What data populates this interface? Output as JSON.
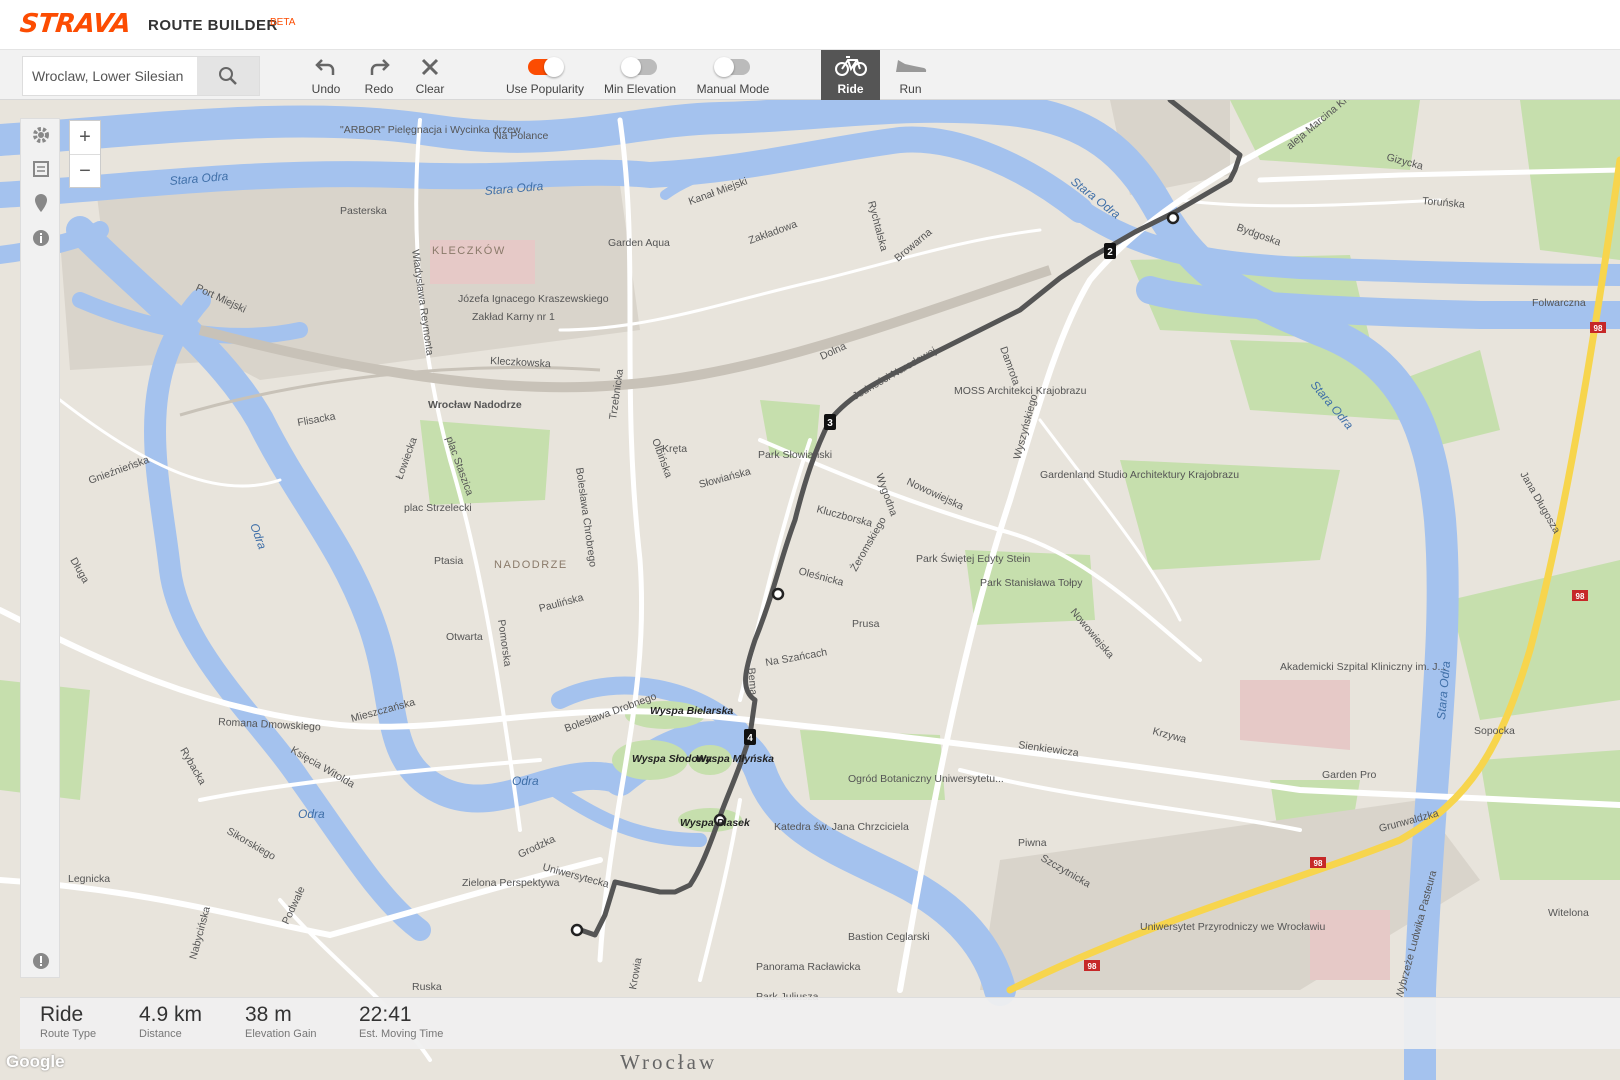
{
  "header": {
    "logo": "STRAVA",
    "title": "ROUTE BUILDER",
    "beta": "BETA"
  },
  "search": {
    "value": "Wroclaw, Lower Silesian",
    "placeholder": "Search"
  },
  "toolbar": {
    "undo": "Undo",
    "redo": "Redo",
    "clear": "Clear",
    "use_popularity": {
      "label": "Use Popularity",
      "on": true
    },
    "min_elevation": {
      "label": "Min Elevation",
      "on": false
    },
    "manual_mode": {
      "label": "Manual Mode",
      "on": false
    },
    "ride": "Ride",
    "run": "Run",
    "active_tab": "Ride"
  },
  "colors": {
    "brand": "#fc4c02",
    "route": "#555555",
    "water": "#a4c2ee",
    "park": "#c6dfad",
    "land": "#e8e4dc"
  },
  "map": {
    "waypoints": [
      "2",
      "3",
      "4"
    ],
    "labels": {
      "water": [
        "Stara Odra",
        "Stara Odra",
        "Odra",
        "Odra",
        "Odra",
        "Stara Odra",
        "Stara Odra",
        "Stara Odra",
        "Kanał Miejski",
        "Port Miejski"
      ],
      "districts": [
        "KLECZKÓW",
        "NADODRZE"
      ],
      "islands": [
        "Wyspa Bielarska",
        "Wyspa Słodowa",
        "Wyspa Młyńska",
        "Wyspa Piasek"
      ],
      "places": [
        "Wrocław Nadodrze",
        "Park Słowiański",
        "Park Stanisława Tołpy",
        "Ogród Botaniczny Uniwersytetu...",
        "Katedra św. Jana Chrzciciela",
        "Bastion Ceglarski",
        "Panorama Racławicka",
        "Zakład Karny nr 1",
        "Józefa Ignacego Kraszewskiego",
        "Garden Aqua",
        "\"ARBOR\" Pielęgnacja i Wycinka drzew",
        "MOSS Architekci Krajobrazu",
        "Gardenland Studio Architektury Krajobrazu",
        "Park Świętej Edyty Stein",
        "Akademicki Szpital Kliniczny im. J...",
        "Uniwersytet Przyrodniczy we Wrocławiu",
        "Garden Pro",
        "Zielona Perspektywa",
        "Park Juliusza"
      ],
      "streets": [
        "Na Polance",
        "Pasterska",
        "Zakładowa",
        "Rychtalska",
        "Browarna",
        "Toruńska",
        "Bydgoska",
        "Gizycka",
        "Folwarczna",
        "aleja Marcina Kromera",
        "Dolna",
        "Jedności Narodowej",
        "Damrota",
        "Wyszyńskiego",
        "Kleczkowska",
        "Trzebnicka",
        "Władysława Reymonta",
        "Flisacka",
        "plac Staszica",
        "Łowiecka",
        "plac Strzelecki",
        "Ptasia",
        "Bolesława Chrobrego",
        "Słowiańska",
        "Kręta",
        "Olbińska",
        "Kluczborska",
        "Oleśnicka",
        "Nowowiejska",
        "Prusa",
        "Żeromskiego",
        "Wygodna",
        "Pomorska",
        "Paulińska",
        "Otwarta",
        "Romana Dmowskiego",
        "Mieszczańska",
        "Bolesława Drobnego",
        "Sienkiewicza",
        "Bema",
        "Na Szańcach",
        "Legnicka",
        "Podwale",
        "Sikorskiego",
        "Grodzka",
        "Uniwersytecka",
        "Nowowiejska",
        "Krzywa",
        "Grunwaldzka",
        "Szczytnicka",
        "Piwna",
        "Wybrzeże Ludwika Pasteura",
        "Sopocka",
        "Witelona",
        "Jana Długosza",
        "Ruska",
        "Krowia",
        "Księcia Witolda",
        "Nabycińska",
        "Rybacka",
        "Długa",
        "Gnieźnieńska"
      ]
    },
    "city": "Wrocław",
    "attribution": "Google"
  },
  "stats": [
    {
      "value": "Ride",
      "label": "Route Type"
    },
    {
      "value": "4.9 km",
      "label": "Distance"
    },
    {
      "value": "38 m",
      "label": "Elevation Gain"
    },
    {
      "value": "22:41",
      "label": "Est. Moving Time"
    }
  ]
}
